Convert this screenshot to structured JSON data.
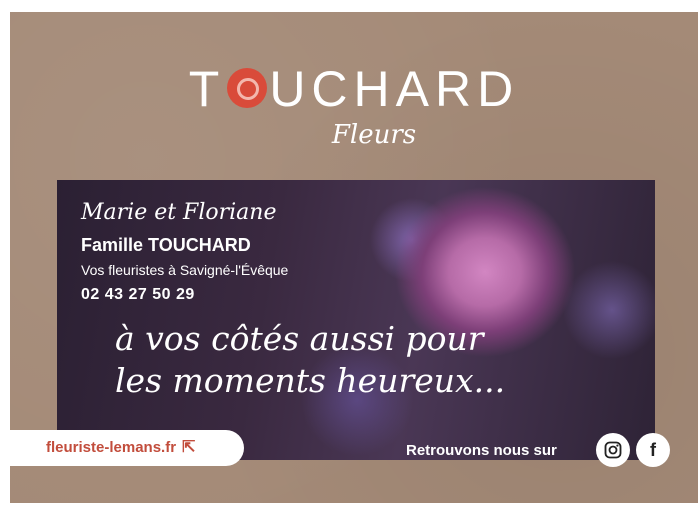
{
  "logo": {
    "brand_left": "T",
    "brand_right": "UCHARD",
    "subtitle": "Fleurs"
  },
  "banner": {
    "names": "Marie et Floriane",
    "family": "Famille TOUCHARD",
    "location": "Vos fleuristes à Savigné-l'Évêque",
    "phone": "02 43 27 50 29",
    "tagline_line1": "à vos côtés aussi pour",
    "tagline_line2": "les moments heureux..."
  },
  "footer": {
    "website": "fleuriste-lemans.fr",
    "social_label": "Retrouvons nous sur",
    "facebook_glyph": "f"
  },
  "colors": {
    "kraft": "#a48a77",
    "accent": "#c24d3c",
    "rose": "#d286c2"
  }
}
